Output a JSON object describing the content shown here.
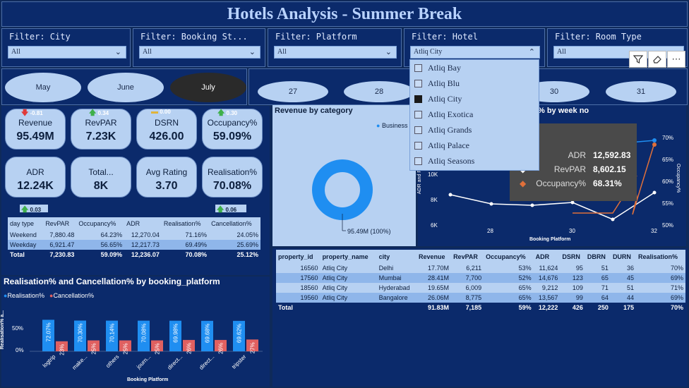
{
  "header": {
    "title": "Hotels Analysis - Summer Break"
  },
  "filters": [
    {
      "label": "Filter: City",
      "value": "All"
    },
    {
      "label": "Filter: Booking St...",
      "value": "All"
    },
    {
      "label": "Filter: Platform",
      "value": "All"
    },
    {
      "label": "Filter: Hotel",
      "value": "Atliq City"
    },
    {
      "label": "Filter: Room Type",
      "value": "All"
    }
  ],
  "months": [
    "May",
    "June",
    "July"
  ],
  "weeks": [
    "27",
    "28",
    "30",
    "31"
  ],
  "hotel_dropdown": {
    "options": [
      "Atliq Bay",
      "Atliq Blu",
      "Atliq City",
      "Atliq Exotica",
      "Atliq Grands",
      "Atliq Palace",
      "Atliq Seasons"
    ],
    "selected": "Atliq City"
  },
  "kpis": [
    {
      "name": "Revenue",
      "value": "95.49M",
      "delta": "-0.81",
      "dir": "down"
    },
    {
      "name": "RevPAR",
      "value": "7.23K",
      "delta": "0.34",
      "dir": "up"
    },
    {
      "name": "DSRN",
      "value": "426.00",
      "delta": "0.00",
      "dir": "flat"
    },
    {
      "name": "Occupancy%",
      "value": "59.09%",
      "delta": "0.30",
      "dir": "up"
    },
    {
      "name": "ADR",
      "value": "12.24K"
    },
    {
      "name": "Total...",
      "value": "8K"
    },
    {
      "name": "Avg Rating",
      "value": "3.70"
    },
    {
      "name": "Realisation%",
      "value": "70.08%"
    }
  ],
  "kpi_extra_deltas": {
    "adr": "0.03",
    "realisation": "0.06"
  },
  "day_table": {
    "headers": [
      "day type",
      "RevPAR",
      "Occupancy%",
      "ADR",
      "Realisation%",
      "Cancellation%"
    ],
    "rows": [
      [
        "Weekend",
        "7,880.48",
        "64.23%",
        "12,270.04",
        "71.16%",
        "24.05%"
      ],
      [
        "Weekday",
        "6,921.47",
        "56.65%",
        "12,217.73",
        "69.49%",
        "25.69%"
      ]
    ],
    "total": [
      "Total",
      "7,230.83",
      "59.09%",
      "12,236.07",
      "70.08%",
      "25.12%"
    ]
  },
  "revenue_category": {
    "title": "Revenue by category",
    "legend": "Business",
    "label": "95.49M (100%)",
    "color": "#1f8ef1"
  },
  "week_chart": {
    "title": "% by week no",
    "y_label": "ADR and Re...",
    "y2_label": "Occupancy%",
    "x_label": "Booking Platform",
    "y_ticks": [
      "10K",
      "8K",
      "6K"
    ],
    "y2_ticks": [
      "70%",
      "65%",
      "60%",
      "55%",
      "50%"
    ],
    "x_ticks": [
      "28",
      "30",
      "32"
    ]
  },
  "tooltip": {
    "header": "32",
    "rows": [
      {
        "key": "ADR",
        "value": "12,592.83",
        "color": "#1f8ef1"
      },
      {
        "key": "RevPAR",
        "value": "8,602.15",
        "color": "#ffffff"
      },
      {
        "key": "Occupancy%",
        "value": "68.31%",
        "color": "#e0703a"
      }
    ]
  },
  "platform_chart": {
    "title": "Realisation% and Cancellation% by booking_platform",
    "legend": [
      {
        "name": "Realisation%",
        "color": "#1f8ef1"
      },
      {
        "name": "Cancellation%",
        "color": "#e06060"
      }
    ],
    "y_label": "Realisation% a...",
    "y_ticks": [
      "50%",
      "0%"
    ],
    "x_label": "Booking Platform"
  },
  "chart_data": {
    "type": "bar",
    "categories": [
      "logtrip",
      "make...",
      "others",
      "journ...",
      "direct...",
      "direct...",
      "tripster"
    ],
    "series": [
      {
        "name": "Realisation%",
        "values": [
          72.07,
          70.3,
          70.14,
          70.08,
          69.98,
          69.68,
          69.62
        ],
        "labels": [
          "72.07%",
          "70.30%",
          "70.14%",
          "70.08%",
          "69.98%",
          "69.68%",
          "69.62%"
        ]
      },
      {
        "name": "Cancellation%",
        "values": [
          23,
          25,
          25,
          25,
          26,
          26,
          27
        ],
        "labels": [
          "23%",
          "25%",
          "25%",
          "25%",
          "26%",
          "26%",
          "27%"
        ]
      }
    ],
    "xlabel": "Booking Platform",
    "ylabel": "Realisation% a...",
    "ylim": [
      0,
      100
    ]
  },
  "property_table": {
    "headers": [
      "property_id",
      "property_name",
      "city",
      "Revenue",
      "RevPAR",
      "Occupancy%",
      "ADR",
      "DSRN",
      "DBRN",
      "DURN",
      "Realisation%"
    ],
    "rows": [
      [
        "16560",
        "Atliq City",
        "Delhi",
        "17.70M",
        "6,211",
        "53%",
        "11,624",
        "95",
        "51",
        "36",
        "70%"
      ],
      [
        "17560",
        "Atliq City",
        "Mumbai",
        "28.41M",
        "7,700",
        "52%",
        "14,676",
        "123",
        "65",
        "45",
        "69%"
      ],
      [
        "18560",
        "Atliq City",
        "Hyderabad",
        "19.65M",
        "6,009",
        "65%",
        "9,212",
        "109",
        "71",
        "51",
        "71%"
      ],
      [
        "19560",
        "Atliq City",
        "Bangalore",
        "26.06M",
        "8,775",
        "65%",
        "13,567",
        "99",
        "64",
        "44",
        "69%"
      ]
    ],
    "total": [
      "Total",
      "",
      "",
      "91.83M",
      "7,185",
      "59%",
      "12,222",
      "426",
      "250",
      "175",
      "70%"
    ]
  }
}
